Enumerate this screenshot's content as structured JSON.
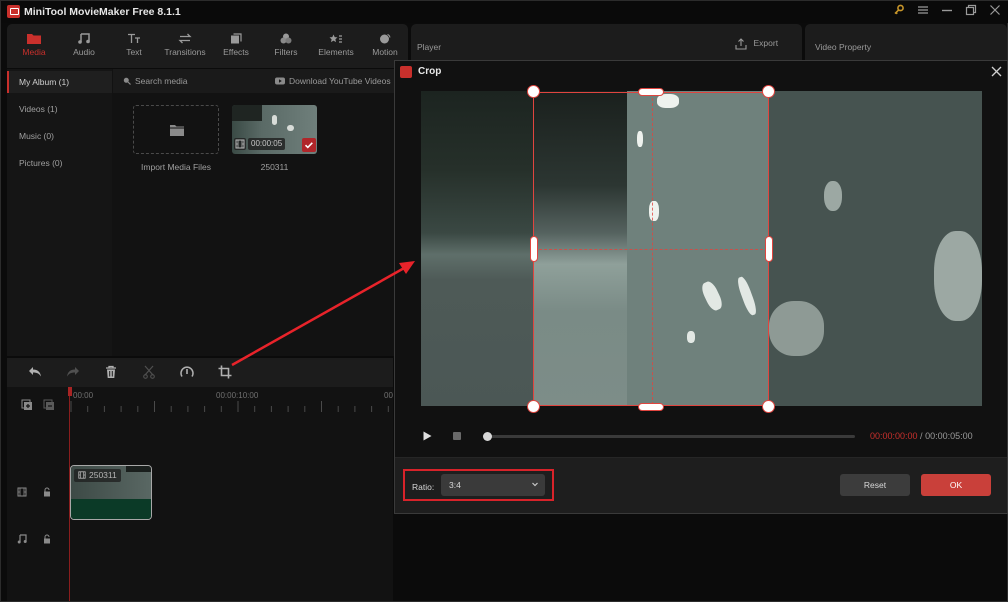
{
  "app": {
    "title": "MiniTool MovieMaker Free 8.1.1",
    "window_controls": [
      "key-icon",
      "menu-icon",
      "minimize-icon",
      "restore-icon",
      "close-icon"
    ],
    "accent_color": "#c9302c"
  },
  "toolbar": {
    "tabs": [
      {
        "label": "Media",
        "icon": "folder-icon",
        "active": true
      },
      {
        "label": "Audio",
        "icon": "music-note-icon",
        "active": false
      },
      {
        "label": "Text",
        "icon": "text-icon",
        "active": false
      },
      {
        "label": "Transitions",
        "icon": "transitions-icon",
        "active": false
      },
      {
        "label": "Effects",
        "icon": "effects-icon",
        "active": false
      },
      {
        "label": "Filters",
        "icon": "filters-icon",
        "active": false
      },
      {
        "label": "Elements",
        "icon": "elements-icon",
        "active": false
      },
      {
        "label": "Motion",
        "icon": "motion-icon",
        "active": false
      }
    ]
  },
  "player": {
    "label": "Player",
    "export_label": "Export"
  },
  "properties": {
    "label": "Video Property"
  },
  "sidebar": {
    "items": [
      {
        "label": "My Album (1)",
        "active": true
      },
      {
        "label": "Videos (1)",
        "active": false
      },
      {
        "label": "Music (0)",
        "active": false
      },
      {
        "label": "Pictures (0)",
        "active": false
      }
    ]
  },
  "media": {
    "search_placeholder": "Search media",
    "download_label": "Download YouTube Videos",
    "import_label": "Import Media Files",
    "clip": {
      "name": "250311",
      "duration": "00:00:05",
      "selected": true
    }
  },
  "timeline": {
    "tools": [
      "undo-icon",
      "redo-icon",
      "delete-icon",
      "split-icon",
      "speed-icon",
      "crop-icon"
    ],
    "ruler_labels": [
      "00:00",
      "00:00:10:00",
      "00"
    ],
    "clip_name": "250311",
    "track_icons": [
      "video-track-icon",
      "audio-track-icon"
    ]
  },
  "crop_dialog": {
    "title": "Crop",
    "time_current": "00:00:00:00",
    "time_separator": " / ",
    "time_total": "00:00:05:00",
    "playback_progress": 0,
    "ratio_label": "Ratio:",
    "ratio_value": "3:4",
    "reset_label": "Reset",
    "ok_label": "OK"
  }
}
